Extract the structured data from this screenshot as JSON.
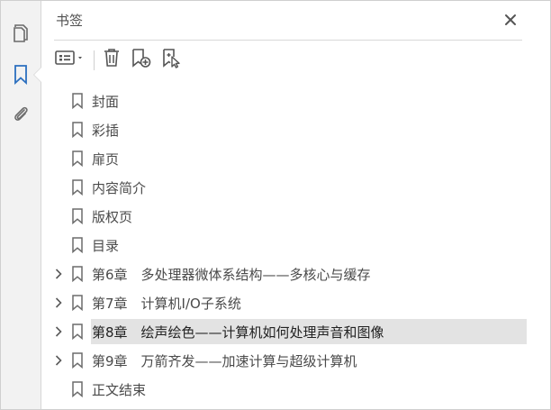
{
  "panel": {
    "title": "书签"
  },
  "rail": {
    "items": [
      {
        "name": "pages-icon",
        "active": false
      },
      {
        "name": "bookmark-icon",
        "active": true
      },
      {
        "name": "attachment-icon",
        "active": false
      }
    ]
  },
  "toolbar": {
    "icons": [
      "options-menu-icon",
      "delete-icon",
      "new-bookmark-icon",
      "new-bookmark-from-selection-icon"
    ]
  },
  "bookmarks": [
    {
      "label": "封面",
      "expandable": false,
      "selected": false
    },
    {
      "label": "彩插",
      "expandable": false,
      "selected": false
    },
    {
      "label": "扉页",
      "expandable": false,
      "selected": false
    },
    {
      "label": "内容简介",
      "expandable": false,
      "selected": false
    },
    {
      "label": "版权页",
      "expandable": false,
      "selected": false
    },
    {
      "label": "目录",
      "expandable": false,
      "selected": false
    },
    {
      "label": "第6章　多处理器微体系结构——多核心与缓存",
      "expandable": true,
      "selected": false
    },
    {
      "label": "第7章　计算机I/O子系统",
      "expandable": true,
      "selected": false
    },
    {
      "label": "第8章　绘声绘色——计算机如何处理声音和图像",
      "expandable": true,
      "selected": true
    },
    {
      "label": "第9章　万箭齐发——加速计算与超级计算机",
      "expandable": true,
      "selected": false
    },
    {
      "label": "正文结束",
      "expandable": false,
      "selected": false
    }
  ],
  "colors": {
    "accent": "#2b6fbf",
    "icon": "#6b6b6b",
    "selection": "#e3e3e3"
  }
}
